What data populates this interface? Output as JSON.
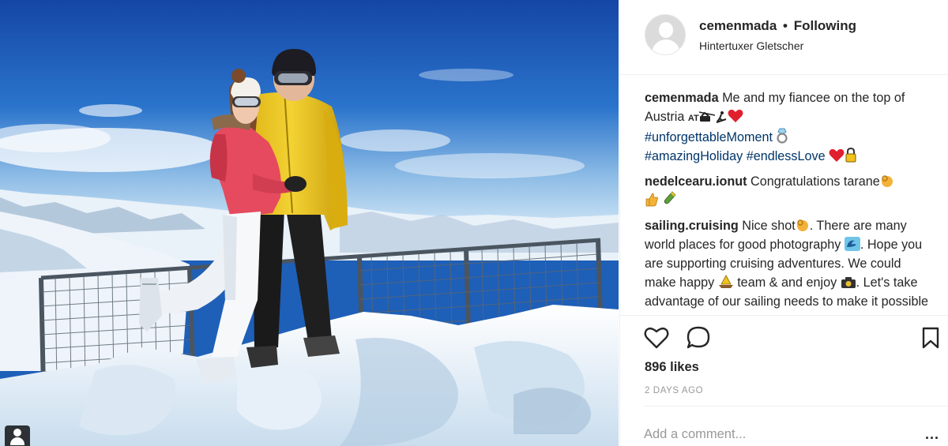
{
  "post": {
    "username": "cemenmada",
    "separator": "•",
    "follow_status": "Following",
    "location": "Hintertuxer Gletscher"
  },
  "comments": [
    {
      "username": "cemenmada",
      "text_1": "Me and my fiancee on the top of Austria",
      "flag_text": "AT",
      "tag_1": "#unforgettableMoment",
      "tag_2": "#amazingHoliday",
      "tag_3": "#endlessLove"
    },
    {
      "username": "nedelcearu.ionut",
      "text": "Congratulations tarane"
    },
    {
      "username": "sailing.cruising",
      "text_1": "Nice shot",
      "text_2": ". There are many world places for good photography",
      "text_3": ". Hope you are supporting cruising adventures. We could make happy",
      "text_4": "team & and enjoy",
      "text_5": ". Let's take advantage of our sailing needs to make it possible"
    }
  ],
  "actions": {
    "like_icon": "heart-icon",
    "comment_icon": "comment-bubble-icon",
    "save_icon": "bookmark-icon"
  },
  "likes": "896 likes",
  "time_ago": "2 DAYS AGO",
  "comment_box": {
    "placeholder": "Add a comment..."
  },
  "more_label": "...",
  "colors": {
    "link": "#003569",
    "text": "#262626",
    "muted": "#999999",
    "divider": "#efefef",
    "jacket_yellow": "#e8c21c",
    "jacket_pink": "#e84860",
    "sky": "#1e5fb8"
  }
}
